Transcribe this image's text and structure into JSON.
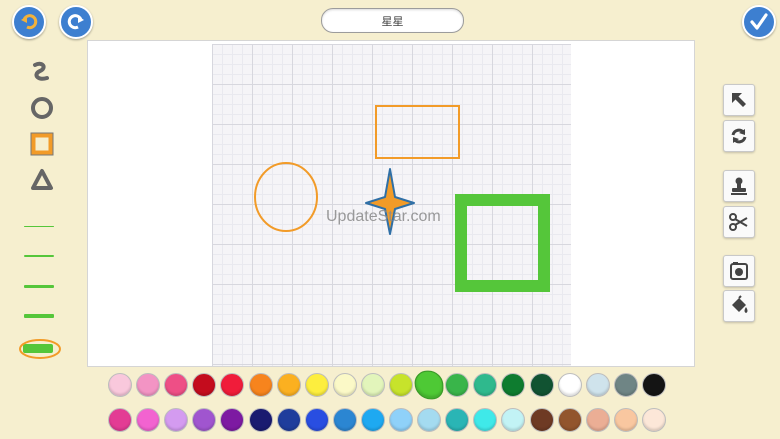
{
  "header": {
    "title": "星星",
    "undo_icon": "undo-icon",
    "redo_icon": "redo-icon",
    "confirm_icon": "check-icon"
  },
  "canvas": {
    "watermark": "UpdateStar.com",
    "shapes": [
      {
        "kind": "circle-outline",
        "color": "#f29b28"
      },
      {
        "kind": "rectangle-outline",
        "color": "#f29b28"
      },
      {
        "kind": "star",
        "fill": "#f29b28",
        "stroke": "#2f6fa6"
      },
      {
        "kind": "square-outline-thick",
        "color": "#55c63a"
      }
    ]
  },
  "left_tools": {
    "items": [
      "freehand-icon",
      "circle-icon",
      "rectangle-icon",
      "triangle-icon"
    ],
    "selected": "rectangle-icon",
    "line_widths": [
      1,
      2,
      3,
      4,
      5
    ],
    "selected_width": 5,
    "line_color": "#55c63a"
  },
  "right_tools": {
    "items": [
      "select-arrow-icon",
      "rotate-icon",
      "stamp-icon",
      "scissors-icon",
      "camera-icon",
      "fill-bucket-icon"
    ]
  },
  "palette": {
    "selected": "#4ec935",
    "row1": [
      "#f9c8dc",
      "#f394c4",
      "#ee4f86",
      "#c40c1d",
      "#f01c3a",
      "#f7841d",
      "#fbb020",
      "#fdee3e",
      "#fbf9c7",
      "#e2f5bb",
      "#c7e32b",
      "#4ec935",
      "#39b54a",
      "#2fb98d",
      "#0e7c2f",
      "#115332",
      "#ffffff",
      "#cfe3ec",
      "#6f8585",
      "#141414"
    ],
    "row2": [
      "#e33c94",
      "#f263d0",
      "#d49bf0",
      "#a055cf",
      "#7d1aa2",
      "#1a1b70",
      "#1f3d9c",
      "#294ee1",
      "#2b86d2",
      "#1ea9f1",
      "#8fd1f9",
      "#a4dbf0",
      "#2ab5b5",
      "#3fe9e9",
      "#c2f3f5",
      "#6e3a24",
      "#92552d",
      "#ebae95",
      "#f9c7a0",
      "#fce7d8"
    ]
  }
}
